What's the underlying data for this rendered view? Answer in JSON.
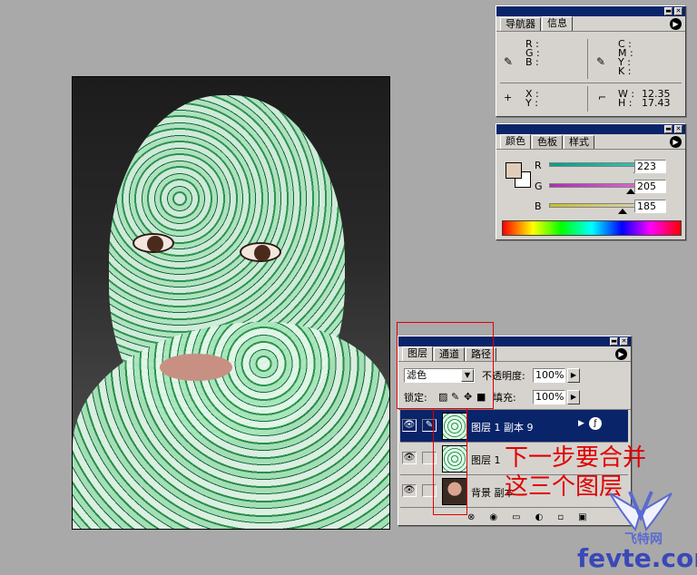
{
  "navigator_panel": {
    "tabs": [
      "导航器",
      "信息"
    ],
    "rgb_labels": [
      "R :",
      "G :",
      "B :"
    ],
    "cmyk_labels": [
      "C :",
      "M :",
      "Y :",
      "K :"
    ],
    "xy_labels": [
      "X :",
      "Y :"
    ],
    "wh_labels": [
      "W :",
      "H :"
    ],
    "w_value": "12.35",
    "h_value": "17.43"
  },
  "color_panel": {
    "tabs": [
      "颜色",
      "色板",
      "样式"
    ],
    "channels": [
      {
        "label": "R",
        "value": "223",
        "fraction": 0.875,
        "color": "#1e9e8a"
      },
      {
        "label": "G",
        "value": "205",
        "fraction": 0.8,
        "color": "#c13cb5"
      },
      {
        "label": "B",
        "value": "185",
        "fraction": 0.725,
        "color": "#b8b02c"
      }
    ],
    "foreground_color": "#dfcdb9",
    "background_color": "#ffffff"
  },
  "layers_panel": {
    "tabs": [
      "图层",
      "通道",
      "路径"
    ],
    "blend_mode": "滤色",
    "opacity_label": "不透明度:",
    "opacity_value": "100%",
    "lock_label": "锁定:",
    "fill_label": "填充:",
    "fill_value": "100%",
    "layers": [
      {
        "name": "图层 1 副本 9",
        "selected": true
      },
      {
        "name": "图层 1",
        "selected": false
      },
      {
        "name": "背景 副本",
        "selected": false
      }
    ]
  },
  "annotation": {
    "line1": "下一步要合并",
    "line2": "这三个图层",
    "color": "#e00000"
  },
  "watermark": {
    "brand": "飞特网",
    "url": "fevte.com"
  }
}
